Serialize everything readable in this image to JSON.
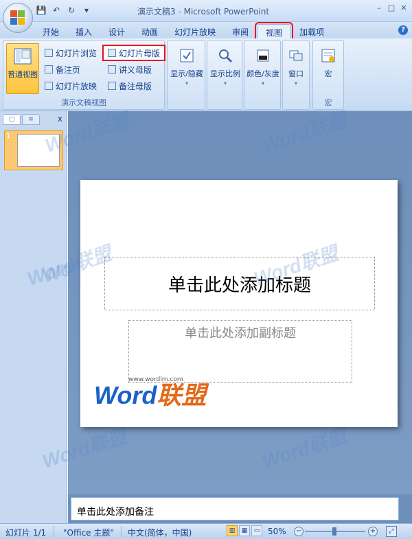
{
  "window": {
    "title": "演示文稿3 - Microsoft PowerPoint",
    "controls": [
      "–",
      "□",
      "✕"
    ]
  },
  "qat": {
    "save": "💾",
    "undo": "↶",
    "redo": "↻",
    "more": "▾"
  },
  "tabs": [
    {
      "label": "开始"
    },
    {
      "label": "插入"
    },
    {
      "label": "设计"
    },
    {
      "label": "动画"
    },
    {
      "label": "幻灯片放映"
    },
    {
      "label": "审阅"
    },
    {
      "label": "视图",
      "active": true
    },
    {
      "label": "加载项"
    }
  ],
  "ribbon": {
    "presentation_views": {
      "label": "演示文稿视图",
      "normal": "普通视图",
      "slide_sorter": "幻灯片浏览",
      "notes_page": "备注页",
      "slide_show": "幻灯片放映",
      "slide_master": "幻灯片母版",
      "handout_master": "讲义母版",
      "notes_master": "备注母版"
    },
    "show_hide": "显示/隐藏",
    "zoom": "显示比例",
    "color_grayscale": "颜色/灰度",
    "window": "窗口",
    "macros": {
      "label": "宏",
      "button": "宏"
    }
  },
  "left_pane": {
    "close": "x",
    "slide_number": "1"
  },
  "slide": {
    "title_placeholder": "单击此处添加标题",
    "subtitle_placeholder": "单击此处添加副标题"
  },
  "watermark": {
    "text": "Word联盟",
    "url": "www.wordlm.com",
    "logo_word": "Word",
    "logo_cn": "联盟"
  },
  "notes_placeholder": "单击此处添加备注",
  "status": {
    "slide_info": "幻灯片 1/1",
    "theme": "\"Office 主题\"",
    "language": "中文(简体，中国)",
    "zoom": "50%"
  },
  "colors": {
    "accent": "#15428b",
    "highlight": "#e8131c",
    "selected": "#ffc43c"
  }
}
